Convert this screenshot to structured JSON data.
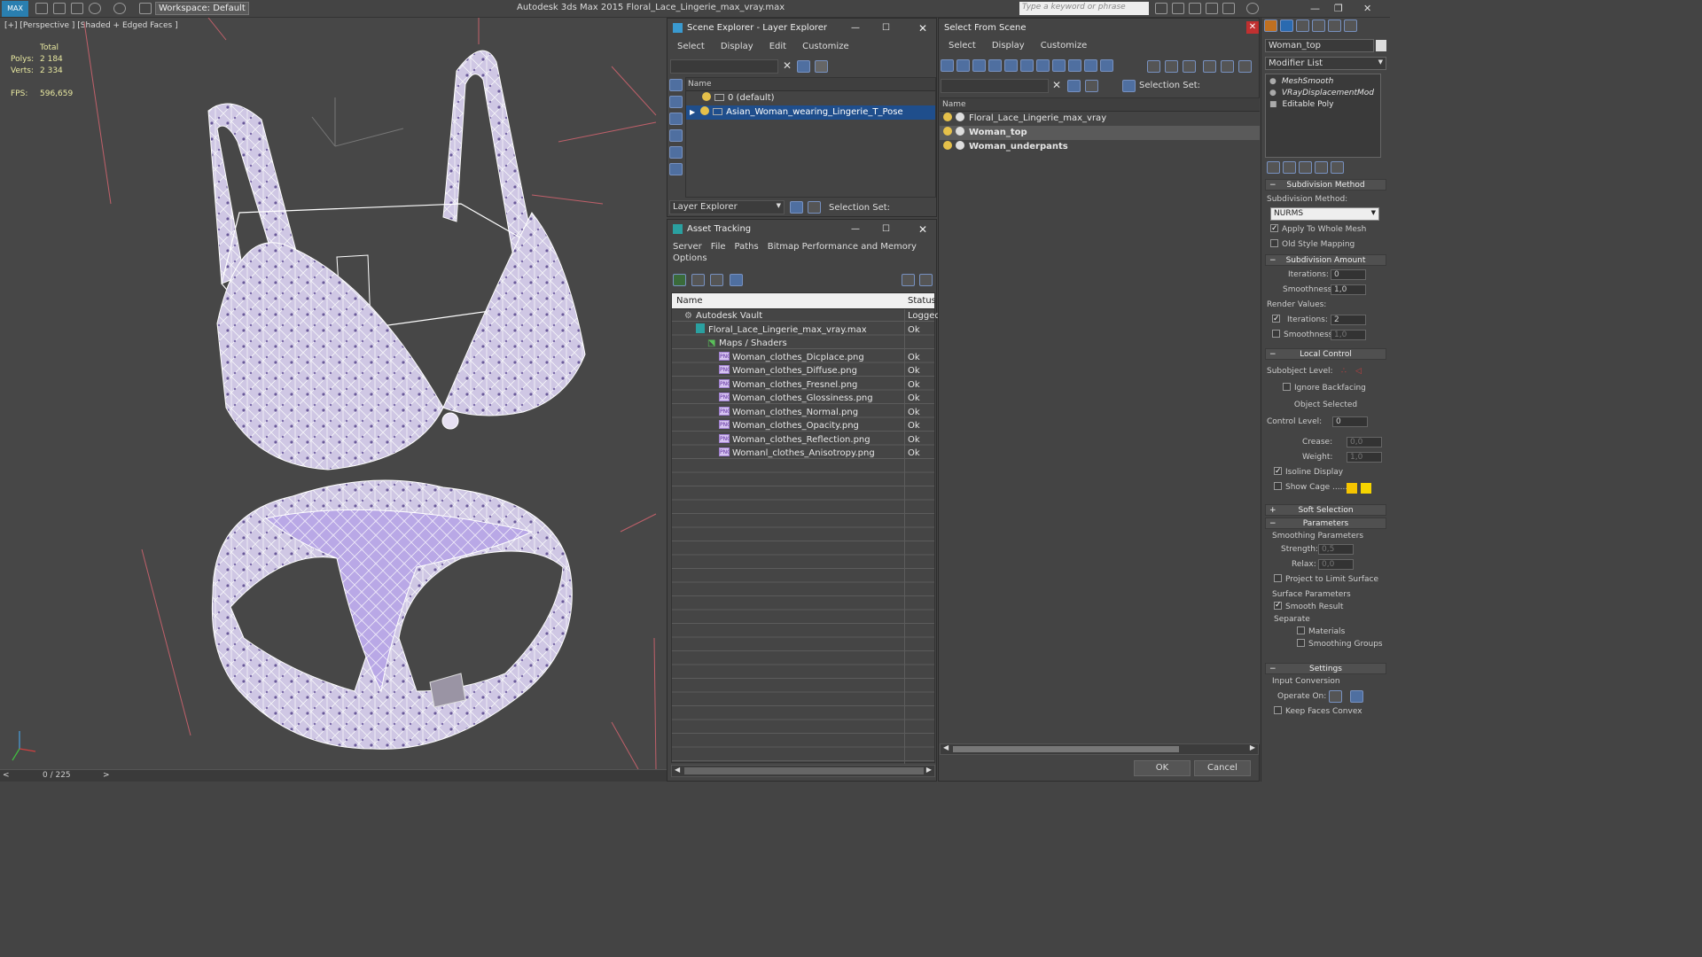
{
  "app": {
    "title": "Autodesk 3ds Max  2015    Floral_Lace_Lingerie_max_vray.max",
    "workspace": "Workspace: Default",
    "search_placeholder": "Type a keyword or phrase"
  },
  "viewport": {
    "label": "[+] [Perspective ] [Shaded + Edged Faces ]",
    "stats": {
      "header": "Total",
      "polys_label": "Polys:",
      "polys": "2 184",
      "verts_label": "Verts:",
      "verts": "2 334",
      "fps_label": "FPS:",
      "fps": "596,659"
    },
    "timeline": "0 / 225"
  },
  "scene_explorer": {
    "title": "Scene Explorer - Layer Explorer",
    "menu": [
      "Select",
      "Display",
      "Edit",
      "Customize"
    ],
    "column": "Name",
    "rows": [
      "0 (default)",
      "Asian_Woman_wearing_Lingerie_T_Pose"
    ],
    "footer_dropdown": "Layer Explorer",
    "selection_set": "Selection Set:"
  },
  "asset_tracking": {
    "title": "Asset Tracking",
    "menu": [
      "Server",
      "File",
      "Paths",
      "Bitmap Performance and Memory"
    ],
    "menu2": "Options",
    "columns": [
      "Name",
      "Status"
    ],
    "rows": [
      {
        "name": "Autodesk Vault",
        "status": "Logged",
        "indent": 0,
        "icon": "vault"
      },
      {
        "name": "Floral_Lace_Lingerie_max_vray.max",
        "status": "Ok",
        "indent": 1,
        "icon": "max"
      },
      {
        "name": "Maps / Shaders",
        "status": "",
        "indent": 2,
        "icon": "maps"
      },
      {
        "name": "Woman_clothes_Dicplace.png",
        "status": "Ok",
        "indent": 3,
        "icon": "png"
      },
      {
        "name": "Woman_clothes_Diffuse.png",
        "status": "Ok",
        "indent": 3,
        "icon": "png"
      },
      {
        "name": "Woman_clothes_Fresnel.png",
        "status": "Ok",
        "indent": 3,
        "icon": "png"
      },
      {
        "name": "Woman_clothes_Glossiness.png",
        "status": "Ok",
        "indent": 3,
        "icon": "png"
      },
      {
        "name": "Woman_clothes_Normal.png",
        "status": "Ok",
        "indent": 3,
        "icon": "png"
      },
      {
        "name": "Woman_clothes_Opacity.png",
        "status": "Ok",
        "indent": 3,
        "icon": "png"
      },
      {
        "name": "Woman_clothes_Reflection.png",
        "status": "Ok",
        "indent": 3,
        "icon": "png"
      },
      {
        "name": "Womanl_clothes_Anisotropy.png",
        "status": "Ok",
        "indent": 3,
        "icon": "png"
      }
    ]
  },
  "select_from_scene": {
    "title": "Select From Scene",
    "menu": [
      "Select",
      "Display",
      "Customize"
    ],
    "selection_set": "Selection Set:",
    "column": "Name",
    "rows": [
      {
        "name": "Floral_Lace_Lingerie_max_vray",
        "selected": false
      },
      {
        "name": "Woman_top",
        "selected": true
      },
      {
        "name": "Woman_underpants",
        "selected": false
      }
    ],
    "ok": "OK",
    "cancel": "Cancel"
  },
  "command_panel": {
    "object_name": "Woman_top",
    "modifier_list": "Modifier List",
    "stack": [
      "MeshSmooth",
      "VRayDisplacementMod",
      "Editable Poly"
    ],
    "subdivision_method": {
      "header": "Subdivision Method",
      "label": "Subdivision Method:",
      "value": "NURMS",
      "apply_whole": "Apply To Whole Mesh",
      "old_style": "Old Style Mapping"
    },
    "subdivision_amount": {
      "header": "Subdivision Amount",
      "iterations_label": "Iterations:",
      "iterations": "0",
      "smoothness_label": "Smoothness:",
      "smoothness": "1,0",
      "render_values": "Render Values:",
      "r_iterations": "2",
      "r_smoothness": "1,0"
    },
    "local_control": {
      "header": "Local Control",
      "subobject": "Subobject Level:",
      "ignore_backfacing": "Ignore Backfacing",
      "object_selected": "Object Selected",
      "control_level_label": "Control Level:",
      "control_level": "0",
      "crease_label": "Crease:",
      "crease": "0,0",
      "weight_label": "Weight:",
      "weight": "1,0",
      "isoline": "Isoline Display",
      "show_cage": "Show Cage ......"
    },
    "soft_selection": "Soft Selection",
    "parameters": {
      "header": "Parameters",
      "smoothing": "Smoothing Parameters",
      "strength_label": "Strength:",
      "strength": "0,5",
      "relax_label": "Relax:",
      "relax": "0,0",
      "project": "Project to Limit Surface",
      "surface": "Surface Parameters",
      "smooth_result": "Smooth Result",
      "separate": "Separate",
      "materials": "Materials",
      "smoothing_groups": "Smoothing Groups"
    },
    "settings": {
      "header": "Settings",
      "input_conversion": "Input Conversion",
      "operate_on": "Operate On:",
      "keep_convex": "Keep Faces Convex"
    },
    "colors": {
      "cage1": "#f5c400",
      "cage2": "#f5d400",
      "selected": "#1f4e8c"
    }
  }
}
